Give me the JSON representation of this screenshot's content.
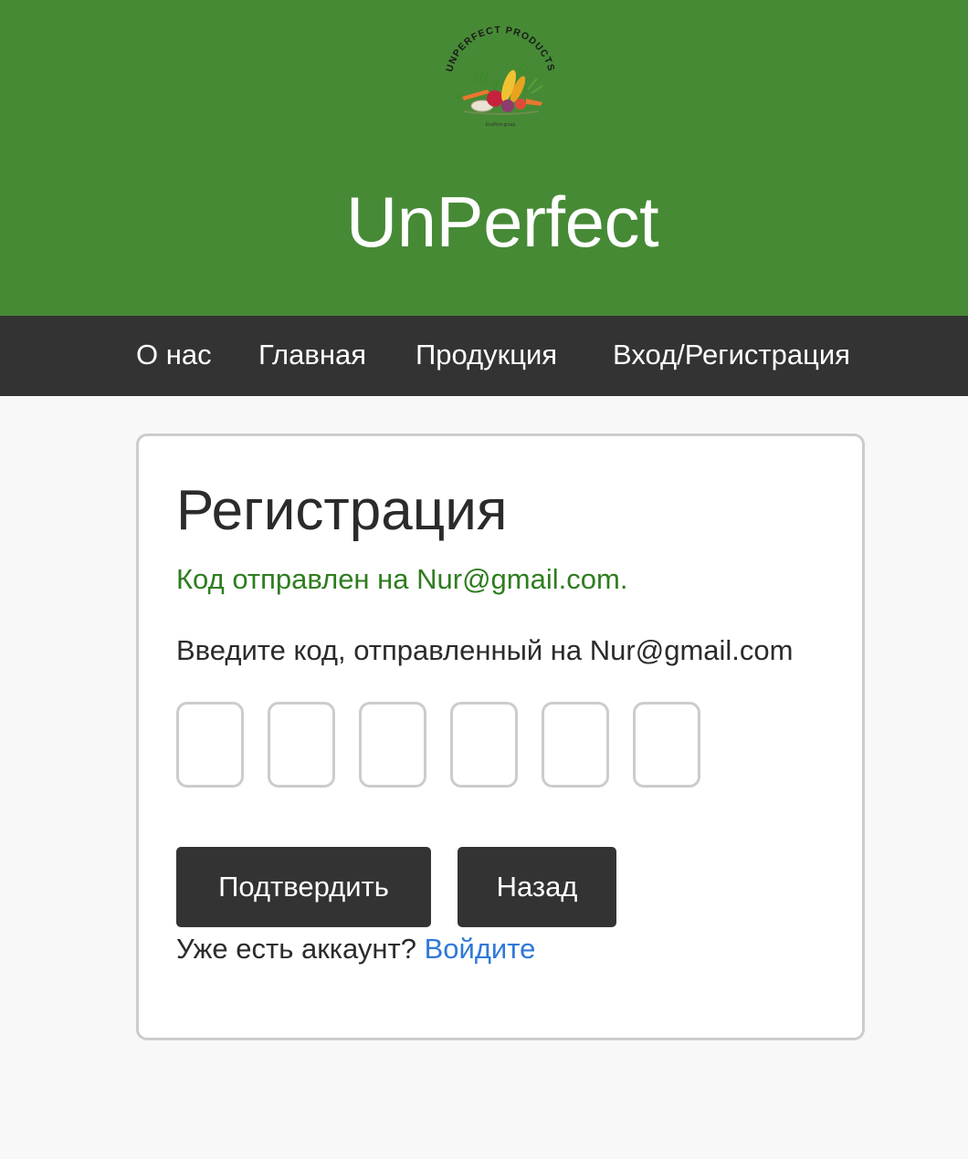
{
  "header": {
    "logo_icon": "unperfect-products-vegetable-logo-icon",
    "logo_text": "UNPERFECT PRODUCTS",
    "site_title": "UnPerfect"
  },
  "nav": {
    "items": [
      {
        "label": "О нас"
      },
      {
        "label": "Главная"
      },
      {
        "label": "Продукция"
      },
      {
        "label": "Вход/Регистрация"
      }
    ]
  },
  "card": {
    "title": "Регистрация",
    "status_message": "Код отправлен на Nur@gmail.com.",
    "instruction": "Введите код, отправленный на Nur@gmail.com",
    "code_boxes": [
      "",
      "",
      "",
      "",
      "",
      ""
    ],
    "confirm_label": "Подтвердить",
    "back_label": "Назад",
    "login_prompt": "Уже есть аккаунт?",
    "login_link": "Войдите"
  },
  "colors": {
    "header_green": "#468a35",
    "nav_dark": "#333333",
    "success_green": "#2e7d1f",
    "link_blue": "#2f78d8",
    "button_dark": "#333333",
    "page_bg": "#f8f8f8"
  }
}
